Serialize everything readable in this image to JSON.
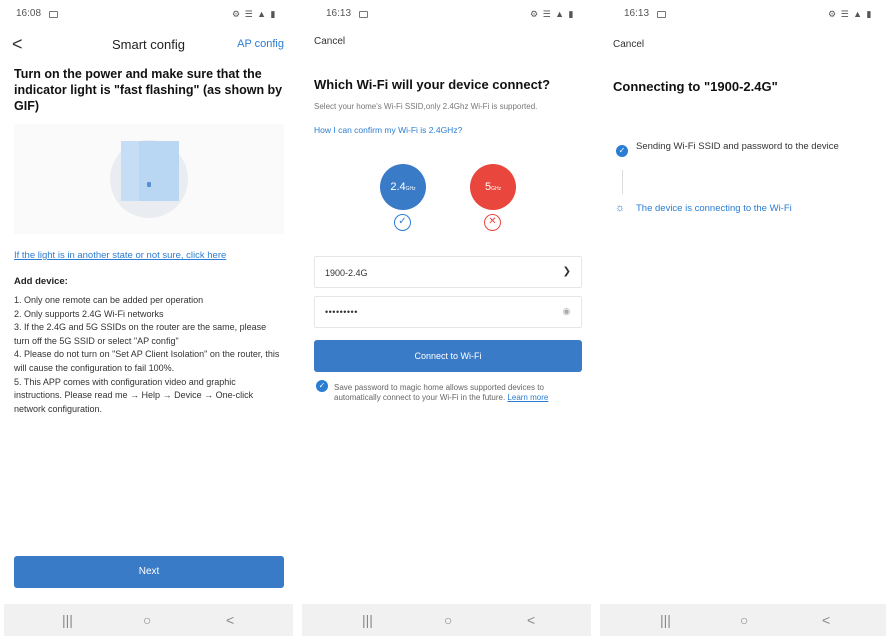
{
  "screen1": {
    "time": "16:08",
    "sys_icons": "⚙ ☰ ▲ ▮",
    "back_label": "<",
    "title": "Smart config",
    "ap_config": "AP config",
    "heading": "Turn on the power and make sure that the indicator light is \"fast flashing\" (as shown by GIF)",
    "state_link": "If the light is in another state or not sure, click here",
    "add_device": "Add device:",
    "rules": [
      "1. Only one remote can be added per operation",
      "2. Only supports 2.4G Wi-Fi networks",
      "3. If the 2.4G and 5G SSIDs on the router are the same, please turn off the 5G SSID or select \"AP config\"",
      "4. Please do not turn on \"Set AP Client Isolation\" on the router, this will cause the configuration to fail 100%.",
      "5. This APP comes with configuration video and graphic instructions. Please read me → Help → Device → One-click network configuration."
    ],
    "next_button": "Next"
  },
  "screen2": {
    "time": "16:13",
    "sys_icons": "⚙ ☰ ▲ ▮",
    "cancel": "Cancel",
    "heading": "Which Wi-Fi will your device connect?",
    "subtitle": "Select your home's Wi-Fi SSID,only 2.4Ghz Wi-Fi is supported.",
    "confirm_link": "How I can confirm my Wi-Fi is 2.4GHz?",
    "band_24": "2.4",
    "band_24_unit": "GHz",
    "band_5": "5",
    "band_5_unit": "GHz",
    "ssid_value": "1900-2.4G",
    "password_value": "•••••••••",
    "connect_button": "Connect to Wi-Fi",
    "save_text": "Save password to magic home allows supported devices to automatically connect to your Wi-Fi in the future.",
    "learn_more": "Learn more"
  },
  "screen3": {
    "time": "16:13",
    "sys_icons": "⚙ ☰ ▲ ▮",
    "cancel": "Cancel",
    "heading": "Connecting to \"1900-2.4G\"",
    "step1": "Sending Wi-Fi SSID and password to the device",
    "step2": "The device is connecting to the Wi-Fi"
  },
  "navbar": {
    "recent": "|||",
    "home": "○",
    "back": "<"
  },
  "colors": {
    "accent": "#3a7bc8",
    "link": "#2a7dd3",
    "danger": "#e9473d"
  }
}
